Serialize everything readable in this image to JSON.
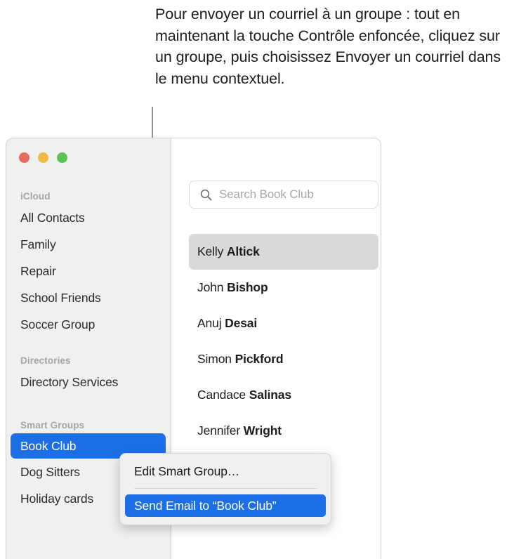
{
  "caption": {
    "text": "Pour envoyer un courriel à un groupe : tout en maintenant la touche Contrôle enfoncée, cliquez sur un groupe, puis choisissez Envoyer un courriel dans le menu contextuel."
  },
  "window": {
    "traffic_lights": {
      "close_label": "close",
      "minimize_label": "minimize",
      "zoom_label": "zoom",
      "close_color": "#e8695f",
      "minimize_color": "#f1ba46",
      "zoom_color": "#5ac352"
    }
  },
  "sidebar": {
    "sections": [
      {
        "header": "iCloud",
        "items": [
          {
            "label": "All Contacts",
            "selected": false
          },
          {
            "label": "Family",
            "selected": false
          },
          {
            "label": "Repair",
            "selected": false
          },
          {
            "label": "School Friends",
            "selected": false
          },
          {
            "label": "Soccer Group",
            "selected": false
          }
        ]
      },
      {
        "header": "Directories",
        "items": [
          {
            "label": "Directory Services",
            "selected": false
          }
        ]
      },
      {
        "header": "Smart Groups",
        "items": [
          {
            "label": "Book Club",
            "selected": true
          },
          {
            "label": "Dog Sitters",
            "selected": false
          },
          {
            "label": "Holiday cards",
            "selected": false
          }
        ]
      }
    ],
    "selection_color": "#1d6fe8"
  },
  "search": {
    "icon": "search-icon",
    "placeholder": "Search Book Club",
    "value": ""
  },
  "contacts": {
    "items": [
      {
        "first": "Kelly",
        "last": "Altick",
        "selected": true
      },
      {
        "first": "John",
        "last": "Bishop",
        "selected": false
      },
      {
        "first": "Anuj",
        "last": "Desai",
        "selected": false
      },
      {
        "first": "Simon",
        "last": "Pickford",
        "selected": false
      },
      {
        "first": "Candace",
        "last": "Salinas",
        "selected": false
      },
      {
        "first": "Jennifer",
        "last": "Wright",
        "selected": false
      }
    ],
    "selection_color": "#d9d9d9"
  },
  "context_menu": {
    "items": [
      {
        "label": "Edit Smart Group…",
        "highlighted": false
      },
      {
        "label": "Send Email to “Book Club”",
        "highlighted": true
      }
    ],
    "highlight_color": "#1d6fe8"
  }
}
